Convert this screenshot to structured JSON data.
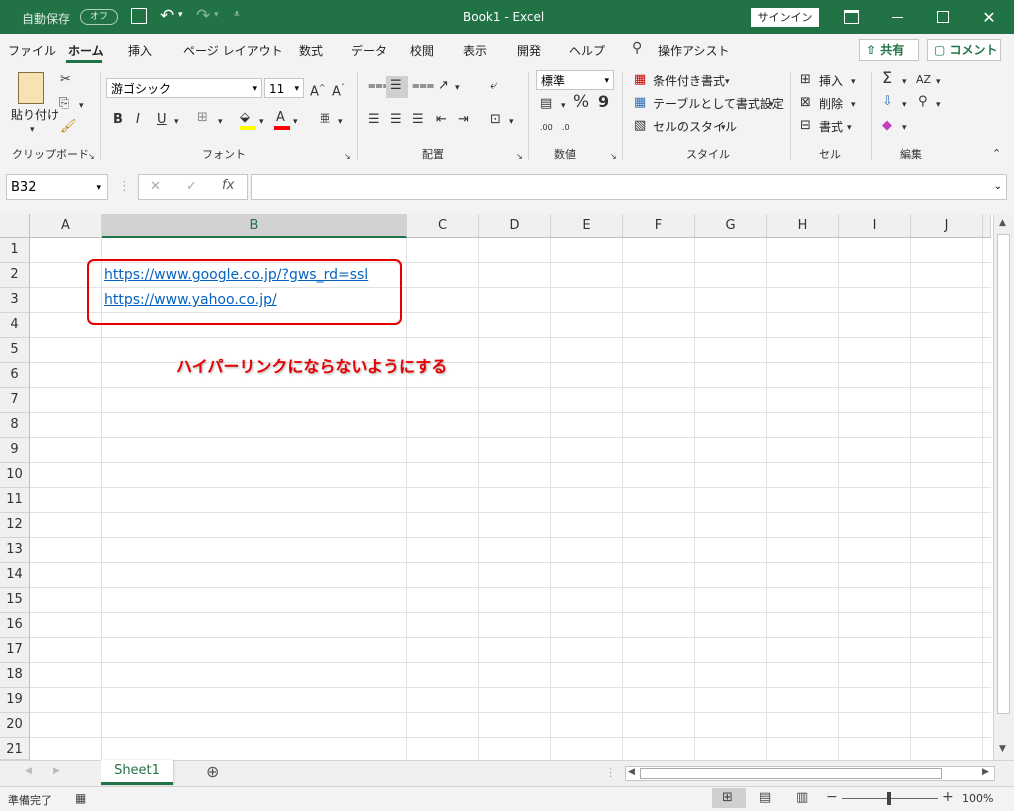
{
  "titlebar": {
    "autosave_label": "自動保存",
    "autosave_toggle": "オフ",
    "title": "Book1  -  Excel",
    "signin": "サインイン"
  },
  "tabs": [
    "ファイル",
    "ホーム",
    "挿入",
    "ページ レイアウト",
    "数式",
    "データ",
    "校閲",
    "表示",
    "開発",
    "ヘルプ"
  ],
  "tell_me": "操作アシスト",
  "share": "共有",
  "comment": "コメント",
  "ribbon": {
    "clipboard": {
      "paste": "貼り付け",
      "label": "クリップボード"
    },
    "font": {
      "name": "游ゴシック",
      "size": "11",
      "bold": "B",
      "italic": "I",
      "underline": "U",
      "label": "フォント",
      "grow": "A",
      "shrink": "A",
      "font_color_glyph": "A",
      "phonetic": "亜"
    },
    "alignment": {
      "label": "配置"
    },
    "number": {
      "format": "標準",
      "percent": "%",
      "comma": "9",
      "label": "数値",
      "increase_decimal": ".00",
      "decrease_decimal": ".0"
    },
    "styles": {
      "conditional": "条件付き書式",
      "table": "テーブルとして書式設定",
      "cell_styles": "セルのスタイル",
      "label": "スタイル"
    },
    "cells": {
      "insert": "挿入",
      "delete": "削除",
      "format": "書式",
      "label": "セル"
    },
    "editing": {
      "label": "編集"
    }
  },
  "formula": {
    "namebox": "B32",
    "value": "",
    "fx": "fx"
  },
  "columns": [
    "A",
    "B",
    "C",
    "D",
    "E",
    "F",
    "G",
    "H",
    "I",
    "J"
  ],
  "rows": [
    "1",
    "2",
    "3",
    "4",
    "5",
    "6",
    "7",
    "8",
    "9",
    "10",
    "11",
    "12",
    "13",
    "14",
    "15",
    "16",
    "17",
    "18",
    "19",
    "20",
    "21"
  ],
  "cells": {
    "B2": "https://www.google.co.jp/?gws_rd=ssl",
    "B3": "https://www.yahoo.co.jp/"
  },
  "annotation": "ハイパーリンクにならないようにする",
  "sheets": [
    "Sheet1"
  ],
  "status": {
    "ready": "準備完了",
    "zoom": "100%"
  },
  "colors": {
    "excel_green": "#217346",
    "link": "#0563c1",
    "annotation_red": "#e60000"
  }
}
